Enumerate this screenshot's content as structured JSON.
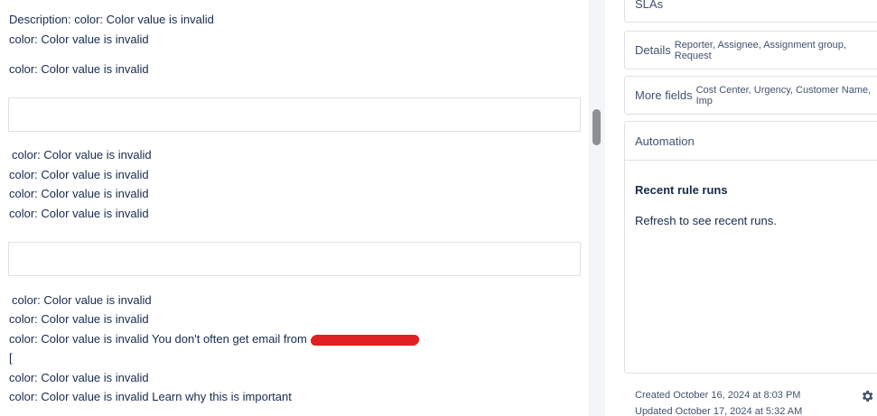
{
  "description_lines": [
    "Description: color: Color value is invalid",
    "color: Color value is invalid",
    "color: Color value is invalid"
  ],
  "block2_lines": [
    " color: Color value is invalid",
    "color: Color value is invalid",
    "color: Color value is invalid",
    "color: Color value is invalid"
  ],
  "block3_lines": [
    " color: Color value is invalid",
    "color: Color value is invalid",
    "color: Color value is invalid You don't often get email from",
    "[",
    "color: Color value is invalid",
    "color: Color value is invalid Learn why this is important"
  ],
  "sidebar": {
    "slas_label": "SLAs",
    "details_label": "Details",
    "details_fields": "Reporter, Assignee, Assignment group, Request",
    "more_fields_label": "More fields",
    "more_fields_list": "Cost Center, Urgency, Customer Name, Imp",
    "automation_label": "Automation",
    "recent_rule_runs": "Recent rule runs",
    "refresh_message": "Refresh to see recent runs.",
    "created": "Created October 16, 2024 at 8:03 PM",
    "updated": "Updated October 17, 2024 at 5:32 AM"
  },
  "icons": {
    "settings": "gear-icon"
  },
  "colors": {
    "redaction": "#e02020",
    "border": "#dfe1e6",
    "text": "#172b4d"
  }
}
